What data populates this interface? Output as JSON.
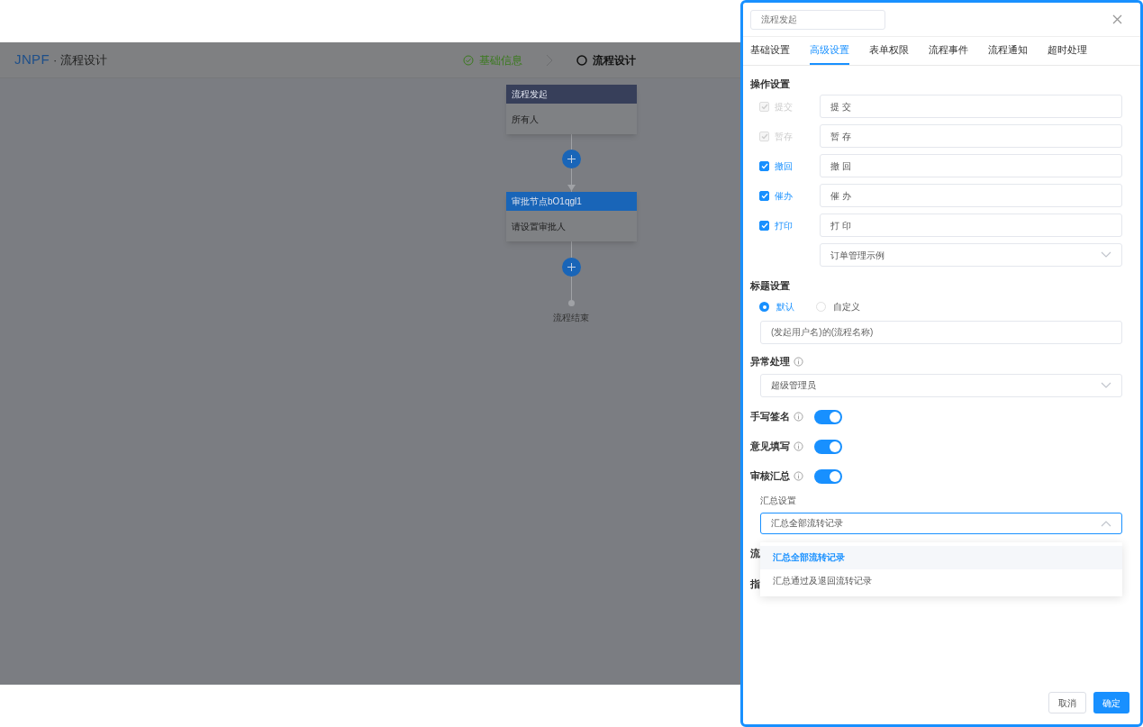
{
  "header": {
    "logo": "JNPF",
    "title": "· 流程设计",
    "steps": [
      {
        "label": "基础信息",
        "done": true
      },
      {
        "label": "流程设计",
        "done": false
      }
    ]
  },
  "flow": {
    "nodes": [
      {
        "kind": "start",
        "title": "流程发起",
        "content": "所有人"
      },
      {
        "kind": "approver",
        "title": "审批节点bO1qgl1",
        "content": "请设置审批人"
      }
    ],
    "end_label": "流程结束"
  },
  "drawer": {
    "name_field": "流程发起",
    "tabs": [
      {
        "label": "基础设置",
        "selected": false
      },
      {
        "label": "高级设置",
        "selected": true
      },
      {
        "label": "表单权限",
        "selected": false
      },
      {
        "label": "流程事件",
        "selected": false
      },
      {
        "label": "流程通知",
        "selected": false
      },
      {
        "label": "超时处理",
        "selected": false
      }
    ],
    "operations": {
      "title": "操作设置",
      "items": [
        {
          "label": "提交",
          "checked": true,
          "disabled": true,
          "value": "提 交"
        },
        {
          "label": "暂存",
          "checked": true,
          "disabled": true,
          "value": "暂 存"
        },
        {
          "label": "撤回",
          "checked": true,
          "disabled": false,
          "value": "撤 回"
        },
        {
          "label": "催办",
          "checked": true,
          "disabled": false,
          "value": "催 办"
        },
        {
          "label": "打印",
          "checked": true,
          "disabled": false,
          "value": "打 印"
        }
      ],
      "print_template": "订单管理示例"
    },
    "title_setting": {
      "title": "标题设置",
      "options": [
        {
          "label": "默认",
          "selected": true
        },
        {
          "label": "自定义",
          "selected": false
        }
      ],
      "value": "(发起用户名)的(流程名称)"
    },
    "exception": {
      "title": "异常处理",
      "value": "超级管理员"
    },
    "switches": [
      {
        "label": "手写签名",
        "on": true
      },
      {
        "label": "意见填写",
        "on": true
      },
      {
        "label": "审核汇总",
        "on": true
      }
    ],
    "summary": {
      "title": "汇总设置",
      "value": "汇总全部流转记录",
      "expanded": true,
      "options": [
        {
          "label": "汇总全部流转记录",
          "selected": true
        },
        {
          "label": "汇总通过及退回流转记录",
          "selected": false
        }
      ]
    },
    "covered_labels": [
      "流",
      "指"
    ],
    "buttons": [
      {
        "label": "取消",
        "kind": "default"
      },
      {
        "label": "确定",
        "kind": "primary"
      }
    ]
  }
}
